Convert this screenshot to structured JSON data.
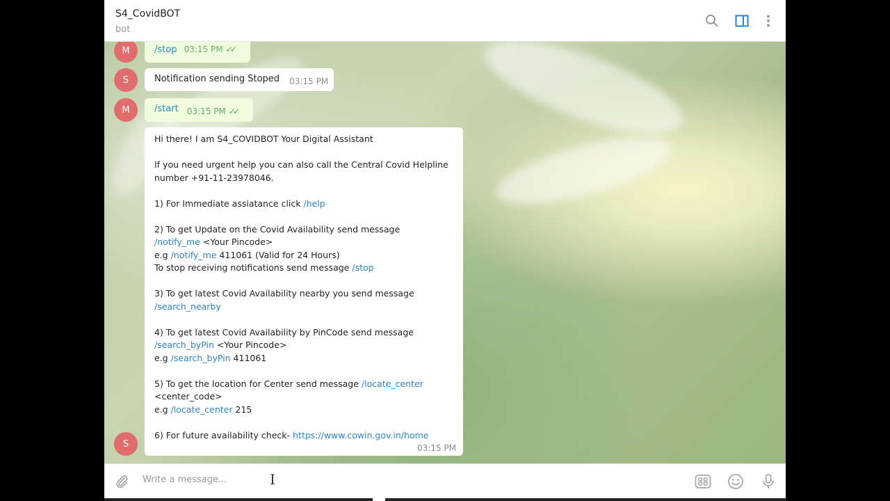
{
  "header": {
    "title": "S4_CovidBOT",
    "subtitle": "bot"
  },
  "icons": {
    "search": "search-icon",
    "sidebar": "sidebar-toggle-icon",
    "menu": "more-vertical-icon",
    "attach": "paperclip-icon",
    "commands": "bot-commands-icon",
    "emoji": "emoji-icon",
    "voice": "microphone-icon"
  },
  "colors": {
    "avatar": "#e06c6c",
    "link": "#2b84c6",
    "outgoing_bubble": "#effdde",
    "accent": "#2b84c6"
  },
  "messages": [
    {
      "avatar": "M",
      "type": "out",
      "text": "/stop",
      "time": "03:15 PM"
    },
    {
      "avatar": "S",
      "type": "in",
      "text": "Notification sending Stoped",
      "time": "03:15 PM"
    },
    {
      "avatar": "M",
      "type": "out",
      "text": "/start",
      "time": "03:15 PM"
    }
  ],
  "welcome": {
    "avatar": "S",
    "time": "03:15 PM",
    "intro": "Hi there! I am S4_COVIDBOT Your Digital Assistant",
    "helpline_1": "If you need urgent help you can also call the Central Covid Helpline",
    "helpline_2": "number +91-11-23978046.",
    "item1_text": " 1) For Immediate assiatance click ",
    "item1_cmd": "/help",
    "item2_line1": " 2) To get Update on the Covid Availability send message",
    "item2_cmd": "/notify_me",
    "item2_arg": " <Your Pincode>",
    "item2_eg_prefix": " e.g ",
    "item2_eg_cmd": "/notify_me",
    "item2_eg_rest": " 411061 (Valid for 24 Hours)",
    "item2_stop_text": " To stop receiving notifications send message ",
    "item2_stop_cmd": "/stop",
    "item3_line1": " 3) To get latest Covid Availability nearby you send message",
    "item3_cmd": "/search_nearby",
    "item4_line1": " 4) To get latest Covid Availability by PinCode send message",
    "item4_cmd": "/search_byPin",
    "item4_arg": " <Your Pincode>",
    "item4_eg_prefix": " e.g ",
    "item4_eg_cmd": "/search_byPin",
    "item4_eg_rest": " 411061",
    "item5_text": " 5) To get the location for Center send message ",
    "item5_cmd": "/locate_center",
    "item5_arg": "<center_code>",
    "item5_eg_prefix": " e.g ",
    "item5_eg_cmd": "/locate_center",
    "item5_eg_rest": " 215",
    "item6_text": " 6) For future availability check-  ",
    "item6_link": "https://www.cowin.gov.in/home"
  },
  "composer": {
    "placeholder": "Write a message..."
  }
}
